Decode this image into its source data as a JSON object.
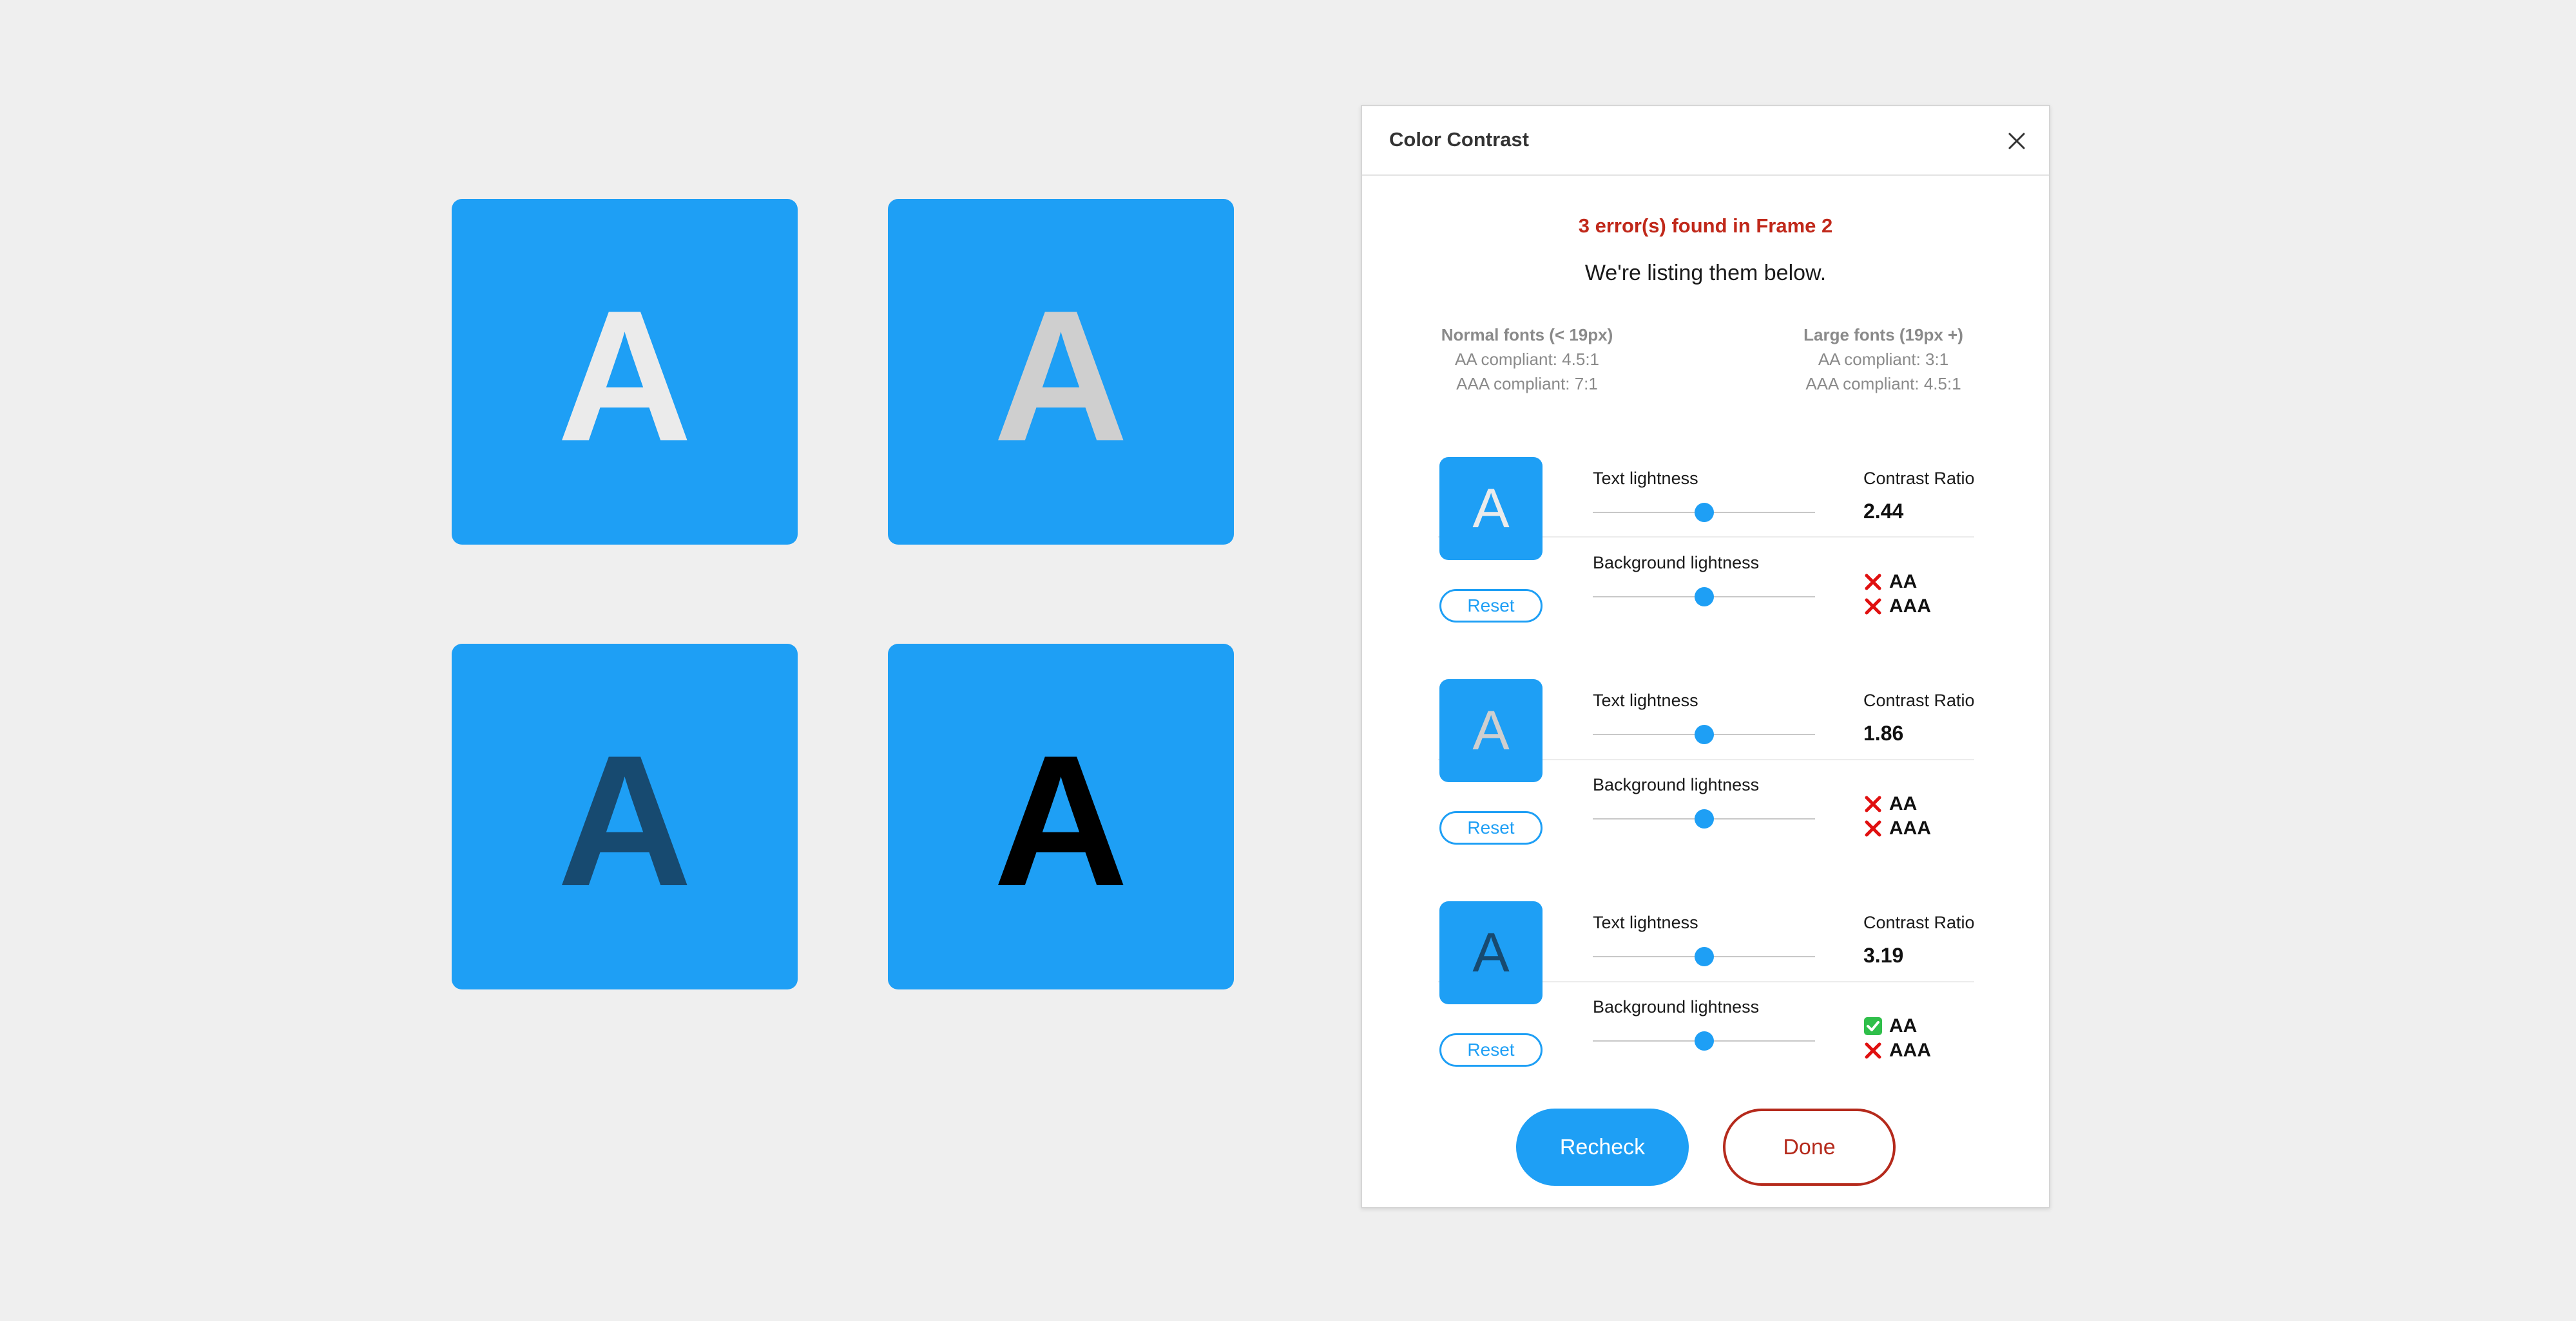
{
  "colors": {
    "page_background": "#efefef",
    "tile_blue": "#1e9ff5",
    "accent": "#1e9ff5",
    "error_red": "#c0281a",
    "done_border": "#b52a1c",
    "fail_mark": "#e01010",
    "pass_mark": "#2fbf4a"
  },
  "canvas": {
    "tiles": [
      {
        "letter": "A",
        "text_color": "#ebebeb",
        "background": "#1e9ff5"
      },
      {
        "letter": "A",
        "text_color": "#cfcfcf",
        "background": "#1e9ff5"
      },
      {
        "letter": "A",
        "text_color": "#174a70",
        "background": "#1e9ff5"
      },
      {
        "letter": "A",
        "text_color": "#000000",
        "background": "#1e9ff5"
      }
    ]
  },
  "panel": {
    "title": "Color Contrast",
    "close_icon": "close-icon",
    "error_summary": "3 error(s) found in Frame 2",
    "subtitle": "We're listing them below.",
    "legend": {
      "normal": {
        "heading": "Normal fonts (< 19px)",
        "aa": "AA compliant: 4.5:1",
        "aaa": "AAA compliant: 7:1"
      },
      "large": {
        "heading": "Large fonts (19px +)",
        "aa": "AA compliant: 3:1",
        "aaa": "AAA compliant: 4.5:1"
      }
    },
    "rows": [
      {
        "preview_letter": "A",
        "preview_text_color": "#ebebeb",
        "preview_background": "#1e9ff5",
        "reset_label": "Reset",
        "text_lightness_label": "Text lightness",
        "text_lightness": 0.5,
        "background_lightness_label": "Background lightness",
        "background_lightness": 0.5,
        "ratio_label": "Contrast Ratio",
        "ratio_value": "2.44",
        "aa_label": "AA",
        "aa_pass": false,
        "aaa_label": "AAA",
        "aaa_pass": false
      },
      {
        "preview_letter": "A",
        "preview_text_color": "#cfcfcf",
        "preview_background": "#1e9ff5",
        "reset_label": "Reset",
        "text_lightness_label": "Text lightness",
        "text_lightness": 0.5,
        "background_lightness_label": "Background lightness",
        "background_lightness": 0.5,
        "ratio_label": "Contrast Ratio",
        "ratio_value": "1.86",
        "aa_label": "AA",
        "aa_pass": false,
        "aaa_label": "AAA",
        "aaa_pass": false
      },
      {
        "preview_letter": "A",
        "preview_text_color": "#174a70",
        "preview_background": "#1e9ff5",
        "reset_label": "Reset",
        "text_lightness_label": "Text lightness",
        "text_lightness": 0.5,
        "background_lightness_label": "Background lightness",
        "background_lightness": 0.5,
        "ratio_label": "Contrast Ratio",
        "ratio_value": "3.19",
        "aa_label": "AA",
        "aa_pass": true,
        "aaa_label": "AAA",
        "aaa_pass": false
      }
    ],
    "buttons": {
      "recheck": "Recheck",
      "done": "Done"
    }
  }
}
